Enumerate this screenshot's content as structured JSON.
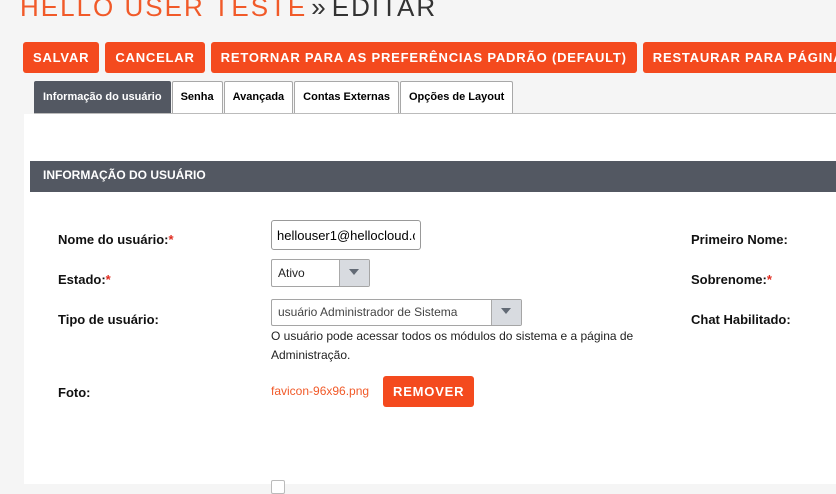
{
  "header": {
    "module_title": "HELLO USER TESTE",
    "separator": "»",
    "action_title": "EDITAR"
  },
  "toolbar": {
    "save_label": "SALVAR",
    "cancel_label": "CANCELAR",
    "reset_prefs_label": "RETORNAR PARA AS PREFERÊNCIAS PADRÃO (DEFAULT)",
    "restore_homepage_label": "RESTAURAR PARA PÁGINA PR"
  },
  "tabs": [
    {
      "label": "Informação do usuário",
      "active": true
    },
    {
      "label": "Senha"
    },
    {
      "label": "Avançada"
    },
    {
      "label": "Contas Externas"
    },
    {
      "label": "Opções de Layout"
    }
  ],
  "section": {
    "title": "INFORMAÇÃO DO USUÁRIO"
  },
  "form": {
    "required_mark": "*",
    "username": {
      "label": "Nome do usuário:",
      "value": "hellouser1@hellocloud.c"
    },
    "status": {
      "label": "Estado:",
      "value": "Ativo"
    },
    "user_type": {
      "label": "Tipo de usuário:",
      "value": "usuário Administrador de Sistema",
      "help": "O usuário pode acessar todos os módulos do sistema e a página de Administração."
    },
    "photo": {
      "label": "Foto:",
      "filename": "favicon-96x96.png",
      "remove_label": "REMOVER"
    },
    "first_name": {
      "label": "Primeiro Nome:"
    },
    "last_name": {
      "label": "Sobrenome:"
    },
    "chat_enabled": {
      "label": "Chat Habilitado:"
    }
  },
  "colors": {
    "accent": "#f44a1e",
    "header_bar": "#535862",
    "required": "#e02b1f"
  }
}
